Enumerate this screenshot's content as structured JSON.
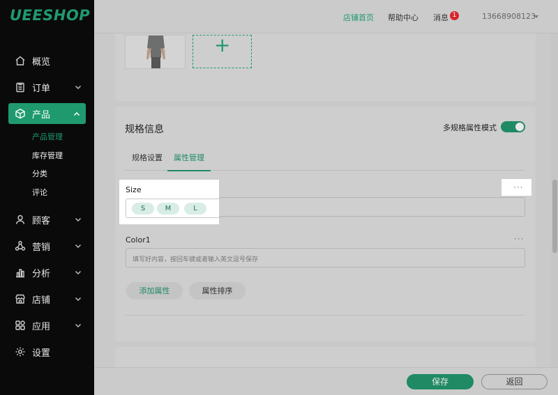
{
  "app": {
    "logo": "UEESHOP"
  },
  "sidebar": {
    "items": [
      {
        "label": "概览",
        "icon": "home-icon"
      },
      {
        "label": "订单",
        "icon": "clipboard-icon"
      },
      {
        "label": "产品",
        "icon": "box-icon",
        "active": true
      },
      {
        "label": "顾客",
        "icon": "user-icon"
      },
      {
        "label": "营销",
        "icon": "network-icon"
      },
      {
        "label": "分析",
        "icon": "bar-chart-icon"
      },
      {
        "label": "店铺",
        "icon": "store-icon"
      },
      {
        "label": "应用",
        "icon": "apps-icon"
      },
      {
        "label": "设置",
        "icon": "gear-icon"
      }
    ],
    "product_sub": [
      "产品管理",
      "库存管理",
      "分类",
      "评论"
    ]
  },
  "topbar": {
    "home": "店铺首页",
    "help": "帮助中心",
    "messages": "消息",
    "message_count": "1",
    "user": "13668908123"
  },
  "spec": {
    "title": "规格信息",
    "toggle_label": "多规格属性模式",
    "tabs": [
      "规格设置",
      "属性管理"
    ],
    "attr1": {
      "label": "Size",
      "chips": [
        "S",
        "M",
        "L"
      ],
      "more": "···"
    },
    "attr2": {
      "label": "Color1",
      "placeholder": "填写好内容，按回车键或者输入英文逗号保存",
      "more": "···"
    },
    "add_attr": "添加属性",
    "sort_attr": "属性排序"
  },
  "footer": {
    "save": "保存",
    "back": "返回"
  },
  "colors": {
    "accent": "#1f9a6f",
    "sidebar_bg": "#0a0a0a",
    "badge": "#d9262b"
  }
}
